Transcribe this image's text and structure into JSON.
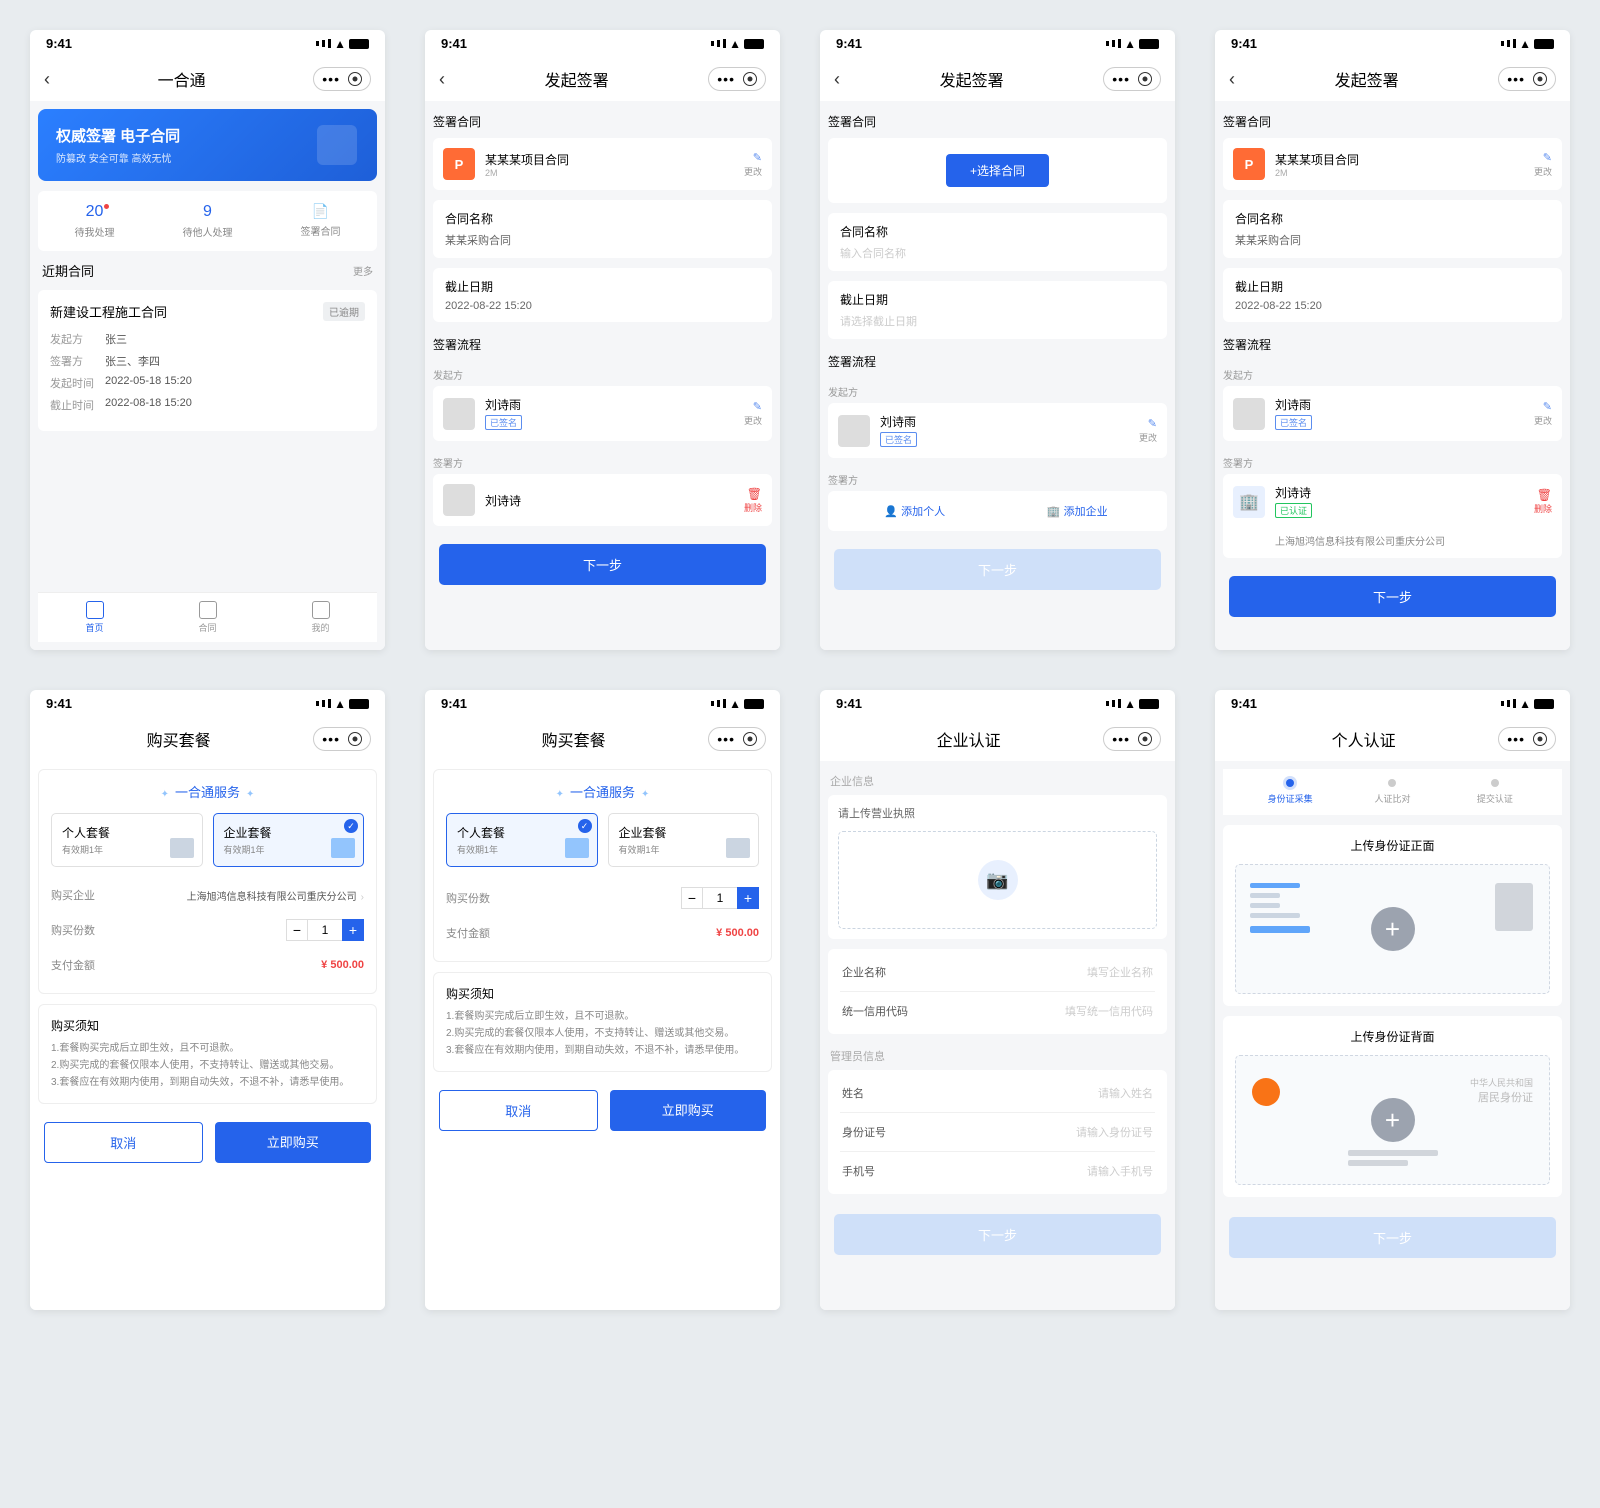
{
  "time": "9:41",
  "s1": {
    "title": "一合通",
    "banner_title": "权威签署 电子合同",
    "banner_sub": "防篡改 安全可靠 高效无忧",
    "stats": [
      {
        "num": "20",
        "lbl": "待我处理",
        "dot": true
      },
      {
        "num": "9",
        "lbl": "待他人处理"
      },
      {
        "num": "",
        "lbl": "签署合同",
        "icon": true
      }
    ],
    "recent": "近期合同",
    "more": "更多",
    "contract": {
      "name": "新建设工程施工合同",
      "status": "已逾期",
      "rows": [
        {
          "l": "发起方",
          "v": "张三"
        },
        {
          "l": "签署方",
          "v": "张三、李四"
        },
        {
          "l": "发起时间",
          "v": "2022-05-18 15:20"
        },
        {
          "l": "截止时间",
          "v": "2022-08-18 15:20"
        }
      ]
    },
    "tabs": [
      "首页",
      "合同",
      "我的"
    ]
  },
  "s2": {
    "title": "发起签署",
    "sec_contract": "签署合同",
    "file": {
      "name": "某某某项目合同",
      "size": "2M",
      "edit": "更改"
    },
    "name_lbl": "合同名称",
    "name_val": "某某采购合同",
    "deadline_lbl": "截止日期",
    "deadline_val": "2022-08-22 15:20",
    "flow": "签署流程",
    "initiator": "发起方",
    "signer": "签署方",
    "p1": {
      "name": "刘诗雨",
      "tag": "已签名"
    },
    "p2": {
      "name": "刘诗诗"
    },
    "edit": "更改",
    "delete": "删除",
    "next": "下一步"
  },
  "s3": {
    "title": "发起签署",
    "sec_contract": "签署合同",
    "select": "+选择合同",
    "name_lbl": "合同名称",
    "name_ph": "输入合同名称",
    "deadline_lbl": "截止日期",
    "deadline_ph": "请选择截止日期",
    "flow": "签署流程",
    "initiator": "发起方",
    "signer": "签署方",
    "p1": {
      "name": "刘诗雨",
      "tag": "已签名"
    },
    "add_person": "添加个人",
    "add_company": "添加企业",
    "edit": "更改",
    "next": "下一步"
  },
  "s4": {
    "title": "发起签署",
    "sec_contract": "签署合同",
    "file": {
      "name": "某某某项目合同",
      "size": "2M"
    },
    "name_lbl": "合同名称",
    "name_val": "某某采购合同",
    "deadline_lbl": "截止日期",
    "deadline_val": "2022-08-22 15:20",
    "flow": "签署流程",
    "initiator": "发起方",
    "signer": "签署方",
    "p1": {
      "name": "刘诗雨",
      "tag": "已签名"
    },
    "p2": {
      "name": "刘诗诗",
      "tag": "已认证",
      "company": "上海旭鸿信息科技有限公司重庆分公司"
    },
    "edit": "更改",
    "delete": "删除",
    "next": "下一步"
  },
  "s5": {
    "title": "购买套餐",
    "service": "一合通服务",
    "pkg1": {
      "name": "个人套餐",
      "sub": "有效期1年"
    },
    "pkg2": {
      "name": "企业套餐",
      "sub": "有效期1年"
    },
    "buy_company_lbl": "购买企业",
    "buy_company_val": "上海旭鸿信息科技有限公司重庆分公司",
    "qty_lbl": "购买份数",
    "qty": "1",
    "price_lbl": "支付金额",
    "price": "¥ 500.00",
    "notice_title": "购买须知",
    "notice": "1.套餐购买完成后立即生效，且不可退款。\n2.购买完成的套餐仅限本人使用，不支持转让、赠送或其他交易。\n3.套餐应在有效期内使用，到期自动失效，不退不补，请悉早使用。",
    "cancel": "取消",
    "buy": "立即购买"
  },
  "s6": {
    "title": "购买套餐",
    "service": "一合通服务",
    "pkg1": {
      "name": "个人套餐",
      "sub": "有效期1年"
    },
    "pkg2": {
      "name": "企业套餐",
      "sub": "有效期1年"
    },
    "qty_lbl": "购买份数",
    "qty": "1",
    "price_lbl": "支付金额",
    "price": "¥ 500.00",
    "notice_title": "购买须知",
    "notice": "1.套餐购买完成后立即生效，且不可退款。\n2.购买完成的套餐仅限本人使用，不支持转让、赠送或其他交易。\n3.套餐应在有效期内使用，到期自动失效，不退不补，请悉早使用。",
    "cancel": "取消",
    "buy": "立即购买"
  },
  "s7": {
    "title": "企业认证",
    "sec": "企业信息",
    "upload": "请上传营业执照",
    "name_lbl": "企业名称",
    "name_ph": "填写企业名称",
    "code_lbl": "统一信用代码",
    "code_ph": "填写统一信用代码",
    "sec2": "管理员信息",
    "admin_name_lbl": "姓名",
    "admin_name_ph": "请输入姓名",
    "id_lbl": "身份证号",
    "id_ph": "请输入身份证号",
    "phone_lbl": "手机号",
    "phone_ph": "请输入手机号",
    "next": "下一步"
  },
  "s8": {
    "title": "个人认证",
    "steps": [
      "身份证采集",
      "人证比对",
      "提交认证"
    ],
    "front": "上传身份证正面",
    "back": "上传身份证背面",
    "id_text1": "中华人民共和国",
    "id_text2": "居民身份证",
    "next": "下一步"
  }
}
